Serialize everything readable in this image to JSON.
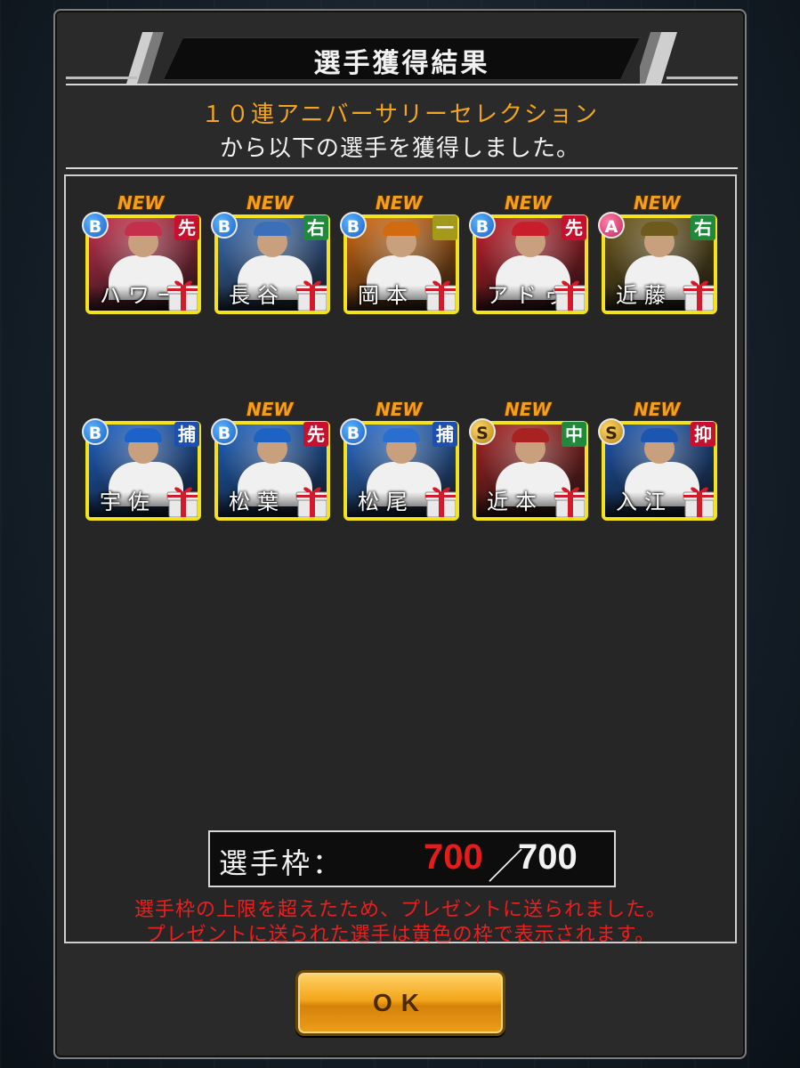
{
  "dialog": {
    "title": "選手獲得結果",
    "message_line1": "１０連アニバーサリーセレクション",
    "message_line2": "から以下の選手を獲得しました。"
  },
  "players": [
    {
      "name": "ハワー",
      "rank": "B",
      "position": "先",
      "position_color": "#c8102e",
      "new": "NEW",
      "art": "#c42f4c"
    },
    {
      "name": "長谷",
      "rank": "B",
      "position": "右",
      "position_color": "#1f8a3b",
      "new": "NEW",
      "art": "#3b6fb8"
    },
    {
      "name": "岡本",
      "rank": "B",
      "position": "一",
      "position_color": "#a39a1c",
      "new": "NEW",
      "art": "#d26a10"
    },
    {
      "name": "アドゥ",
      "rank": "B",
      "position": "先",
      "position_color": "#c8102e",
      "new": "NEW",
      "art": "#c81e2b"
    },
    {
      "name": "近藤",
      "rank": "A",
      "position": "右",
      "position_color": "#1f8a3b",
      "new": "NEW",
      "art": "#6e5a1c"
    },
    {
      "name": "宇佐",
      "rank": "B",
      "position": "捕",
      "position_color": "#1d4fb0",
      "new": "",
      "art": "#1d62c8"
    },
    {
      "name": "松葉",
      "rank": "B",
      "position": "先",
      "position_color": "#c8102e",
      "new": "NEW",
      "art": "#1e63c4"
    },
    {
      "name": "松尾",
      "rank": "B",
      "position": "捕",
      "position_color": "#1d4fb0",
      "new": "NEW",
      "art": "#2a6fd0"
    },
    {
      "name": "近本",
      "rank": "S",
      "position": "中",
      "position_color": "#1f8a3b",
      "new": "NEW",
      "art": "#a82222"
    },
    {
      "name": "入江",
      "rank": "S",
      "position": "抑",
      "position_color": "#c8102e",
      "new": "NEW",
      "art": "#1c56b0"
    }
  ],
  "capacity": {
    "label": "選手枠：",
    "current": "700",
    "separator": "／",
    "max": "700",
    "current_color": "#e61c1c"
  },
  "notice": {
    "line1": "選手枠の上限を超えたため、プレゼントに送られました。",
    "line2": "プレゼントに送られた選手は黄色の枠で表示されます。"
  },
  "ok_button": {
    "label": "OK"
  },
  "colors": {
    "frame_yellow": "#f4e31a",
    "accent_orange": "#f3a51f",
    "notice_red": "#ec1f1f"
  }
}
